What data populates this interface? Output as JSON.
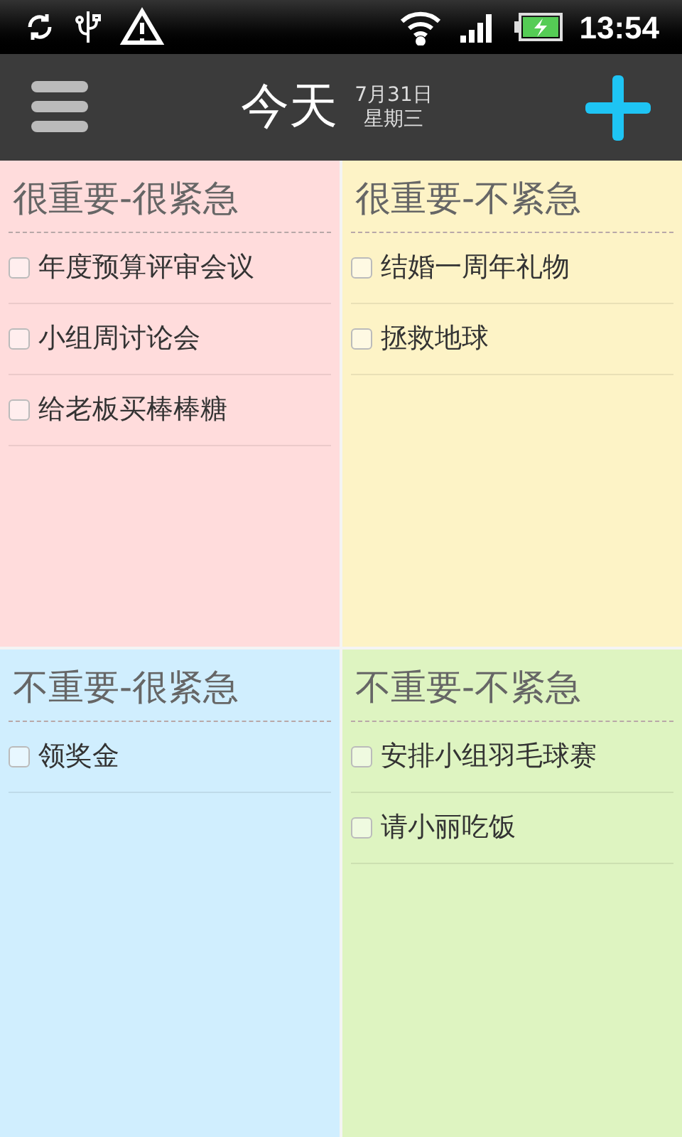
{
  "status_bar": {
    "time": "13:54"
  },
  "header": {
    "title": "今天",
    "date": "7月31日",
    "weekday": "星期三"
  },
  "quadrants": [
    {
      "title": "很重要-很紧急",
      "color": "#ffdcdc",
      "items": [
        {
          "text": "年度预算评审会议",
          "checked": false
        },
        {
          "text": "小组周讨论会",
          "checked": false
        },
        {
          "text": "给老板买棒棒糖",
          "checked": false
        }
      ]
    },
    {
      "title": "很重要-不紧急",
      "color": "#fdf3c6",
      "items": [
        {
          "text": "结婚一周年礼物",
          "checked": false
        },
        {
          "text": "拯救地球",
          "checked": false
        }
      ]
    },
    {
      "title": "不重要-很紧急",
      "color": "#d0eefe",
      "items": [
        {
          "text": "领奖金",
          "checked": false
        }
      ]
    },
    {
      "title": "不重要-不紧急",
      "color": "#def4c1",
      "items": [
        {
          "text": "安排小组羽毛球赛",
          "checked": false
        },
        {
          "text": "请小丽吃饭",
          "checked": false
        }
      ]
    }
  ]
}
